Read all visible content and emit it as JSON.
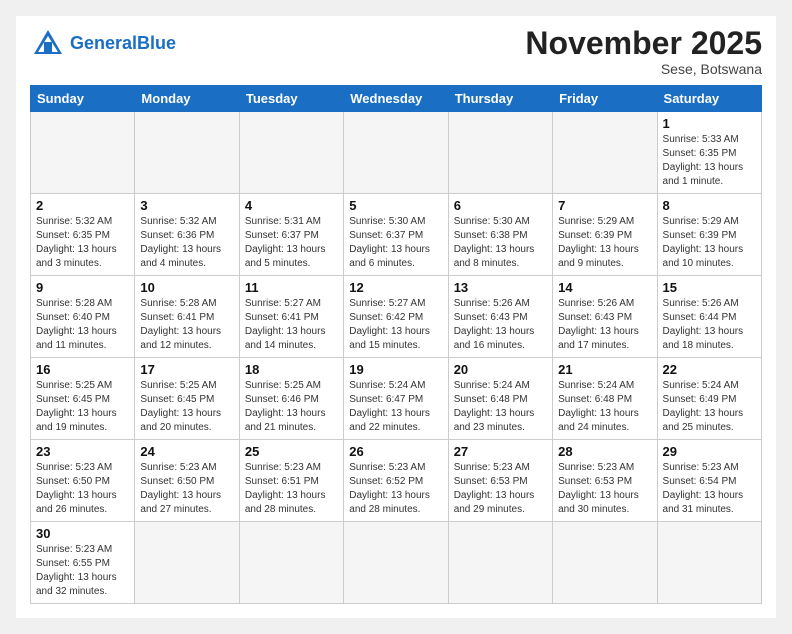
{
  "header": {
    "logo_general": "General",
    "logo_blue": "Blue",
    "month_title": "November 2025",
    "location": "Sese, Botswana"
  },
  "weekdays": [
    "Sunday",
    "Monday",
    "Tuesday",
    "Wednesday",
    "Thursday",
    "Friday",
    "Saturday"
  ],
  "weeks": [
    [
      {
        "day": "",
        "info": ""
      },
      {
        "day": "",
        "info": ""
      },
      {
        "day": "",
        "info": ""
      },
      {
        "day": "",
        "info": ""
      },
      {
        "day": "",
        "info": ""
      },
      {
        "day": "",
        "info": ""
      },
      {
        "day": "1",
        "info": "Sunrise: 5:33 AM\nSunset: 6:35 PM\nDaylight: 13 hours\nand 1 minute."
      }
    ],
    [
      {
        "day": "2",
        "info": "Sunrise: 5:32 AM\nSunset: 6:35 PM\nDaylight: 13 hours\nand 3 minutes."
      },
      {
        "day": "3",
        "info": "Sunrise: 5:32 AM\nSunset: 6:36 PM\nDaylight: 13 hours\nand 4 minutes."
      },
      {
        "day": "4",
        "info": "Sunrise: 5:31 AM\nSunset: 6:37 PM\nDaylight: 13 hours\nand 5 minutes."
      },
      {
        "day": "5",
        "info": "Sunrise: 5:30 AM\nSunset: 6:37 PM\nDaylight: 13 hours\nand 6 minutes."
      },
      {
        "day": "6",
        "info": "Sunrise: 5:30 AM\nSunset: 6:38 PM\nDaylight: 13 hours\nand 8 minutes."
      },
      {
        "day": "7",
        "info": "Sunrise: 5:29 AM\nSunset: 6:39 PM\nDaylight: 13 hours\nand 9 minutes."
      },
      {
        "day": "8",
        "info": "Sunrise: 5:29 AM\nSunset: 6:39 PM\nDaylight: 13 hours\nand 10 minutes."
      }
    ],
    [
      {
        "day": "9",
        "info": "Sunrise: 5:28 AM\nSunset: 6:40 PM\nDaylight: 13 hours\nand 11 minutes."
      },
      {
        "day": "10",
        "info": "Sunrise: 5:28 AM\nSunset: 6:41 PM\nDaylight: 13 hours\nand 12 minutes."
      },
      {
        "day": "11",
        "info": "Sunrise: 5:27 AM\nSunset: 6:41 PM\nDaylight: 13 hours\nand 14 minutes."
      },
      {
        "day": "12",
        "info": "Sunrise: 5:27 AM\nSunset: 6:42 PM\nDaylight: 13 hours\nand 15 minutes."
      },
      {
        "day": "13",
        "info": "Sunrise: 5:26 AM\nSunset: 6:43 PM\nDaylight: 13 hours\nand 16 minutes."
      },
      {
        "day": "14",
        "info": "Sunrise: 5:26 AM\nSunset: 6:43 PM\nDaylight: 13 hours\nand 17 minutes."
      },
      {
        "day": "15",
        "info": "Sunrise: 5:26 AM\nSunset: 6:44 PM\nDaylight: 13 hours\nand 18 minutes."
      }
    ],
    [
      {
        "day": "16",
        "info": "Sunrise: 5:25 AM\nSunset: 6:45 PM\nDaylight: 13 hours\nand 19 minutes."
      },
      {
        "day": "17",
        "info": "Sunrise: 5:25 AM\nSunset: 6:45 PM\nDaylight: 13 hours\nand 20 minutes."
      },
      {
        "day": "18",
        "info": "Sunrise: 5:25 AM\nSunset: 6:46 PM\nDaylight: 13 hours\nand 21 minutes."
      },
      {
        "day": "19",
        "info": "Sunrise: 5:24 AM\nSunset: 6:47 PM\nDaylight: 13 hours\nand 22 minutes."
      },
      {
        "day": "20",
        "info": "Sunrise: 5:24 AM\nSunset: 6:48 PM\nDaylight: 13 hours\nand 23 minutes."
      },
      {
        "day": "21",
        "info": "Sunrise: 5:24 AM\nSunset: 6:48 PM\nDaylight: 13 hours\nand 24 minutes."
      },
      {
        "day": "22",
        "info": "Sunrise: 5:24 AM\nSunset: 6:49 PM\nDaylight: 13 hours\nand 25 minutes."
      }
    ],
    [
      {
        "day": "23",
        "info": "Sunrise: 5:23 AM\nSunset: 6:50 PM\nDaylight: 13 hours\nand 26 minutes."
      },
      {
        "day": "24",
        "info": "Sunrise: 5:23 AM\nSunset: 6:50 PM\nDaylight: 13 hours\nand 27 minutes."
      },
      {
        "day": "25",
        "info": "Sunrise: 5:23 AM\nSunset: 6:51 PM\nDaylight: 13 hours\nand 28 minutes."
      },
      {
        "day": "26",
        "info": "Sunrise: 5:23 AM\nSunset: 6:52 PM\nDaylight: 13 hours\nand 28 minutes."
      },
      {
        "day": "27",
        "info": "Sunrise: 5:23 AM\nSunset: 6:53 PM\nDaylight: 13 hours\nand 29 minutes."
      },
      {
        "day": "28",
        "info": "Sunrise: 5:23 AM\nSunset: 6:53 PM\nDaylight: 13 hours\nand 30 minutes."
      },
      {
        "day": "29",
        "info": "Sunrise: 5:23 AM\nSunset: 6:54 PM\nDaylight: 13 hours\nand 31 minutes."
      }
    ],
    [
      {
        "day": "30",
        "info": "Sunrise: 5:23 AM\nSunset: 6:55 PM\nDaylight: 13 hours\nand 32 minutes."
      },
      {
        "day": "",
        "info": ""
      },
      {
        "day": "",
        "info": ""
      },
      {
        "day": "",
        "info": ""
      },
      {
        "day": "",
        "info": ""
      },
      {
        "day": "",
        "info": ""
      },
      {
        "day": "",
        "info": ""
      }
    ]
  ]
}
